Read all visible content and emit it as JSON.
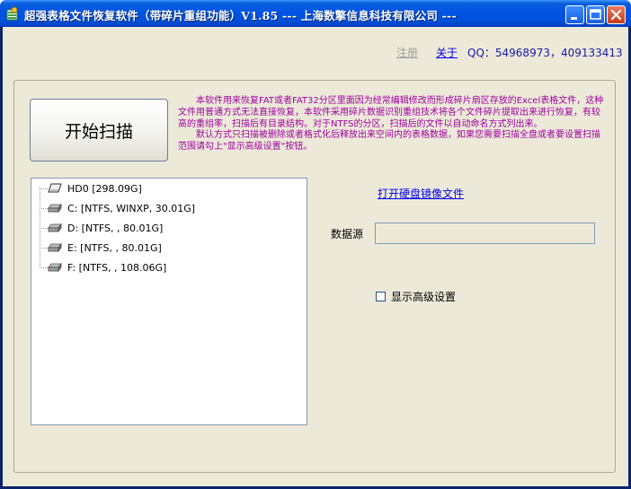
{
  "window": {
    "title": "超强表格文件恢复软件（带碎片重组功能）V1.85 --- 上海数擎信息科技有限公司 ---",
    "controls": {
      "minimize": "minimize",
      "maximize": "maximize",
      "close": "close"
    }
  },
  "header": {
    "register_label": "注册",
    "about_label": "关于",
    "qq_text": "QQ：54968973，409133413"
  },
  "scan_button_label": "开始扫描",
  "description": {
    "paragraph1": "本软件用来恢复FAT或者FAT32分区里面因为经常编辑修改而形成碎片扇区存放的Excel表格文件，这种文件用普通方式无法直接恢复，本软件采用碎片数据识别重组技术将各个文件碎片提取出来进行恢复，有较高的重组率，扫描后有目录结构。对于NTFS的分区，扫描后的文件以自动命名方式列出来。",
    "paragraph2": "默认方式只扫描被删除或者格式化后释放出来空间内的表格数据，如果您需要扫描全盘或者要设置扫描范围请勾上\"显示高级设置\"按钮。"
  },
  "drive_tree": {
    "root": {
      "label": "HD0   [298.09G]",
      "icon": "hard-disk-icon"
    },
    "partitions": [
      {
        "label": "C:   [NTFS, WINXP, 30.01G]",
        "icon": "drive-icon"
      },
      {
        "label": "D:   [NTFS, , 80.01G]",
        "icon": "drive-icon"
      },
      {
        "label": "E:   [NTFS, , 80.01G]",
        "icon": "drive-icon"
      },
      {
        "label": "F:   [NTFS, , 108.06G]",
        "icon": "drive-icon"
      }
    ]
  },
  "open_image_link": "打开硬盘镜像文件",
  "data_source": {
    "label": "数据源",
    "value": ""
  },
  "advanced_settings": {
    "label": "显示高级设置",
    "checked": false
  },
  "colors": {
    "title_bar": "#0054e3",
    "client_bg": "#ece9d8",
    "description_text": "#a000a0",
    "link": "#0000ee",
    "qq_text": "#1a1aa6"
  }
}
